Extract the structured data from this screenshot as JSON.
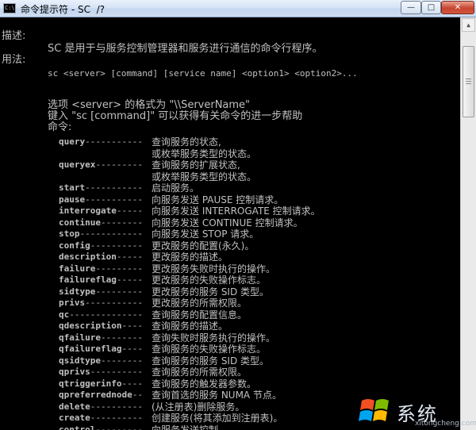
{
  "window": {
    "title": "命令提示符 - SC  /?",
    "icon_text": "C:\\",
    "controls": {
      "minimize": "—",
      "maximize": "□",
      "close": "✕"
    }
  },
  "console": {
    "describe_label": "描述:",
    "describe_text": "SC 是用于与服务控制管理器和服务进行通信的命令行程序。",
    "usage_label": "用法:",
    "usage_text": "sc <server> [command] [service name] <option1> <option2>...",
    "option_line": "选项 <server> 的格式为 \"\\\\ServerName\"",
    "help_line": "键入 \"sc [command]\" 可以获得有关命令的进一步帮助",
    "commands_label": "命令:",
    "commands": [
      {
        "name": "query",
        "dashes": "-----------",
        "desc": "查询服务的状态,",
        "desc2": "或枚举服务类型的状态。"
      },
      {
        "name": "queryex",
        "dashes": "---------",
        "desc": "查询服务的扩展状态,",
        "desc2": "或枚举服务类型的状态。"
      },
      {
        "name": "start",
        "dashes": "-----------",
        "desc": "启动服务。"
      },
      {
        "name": "pause",
        "dashes": "-----------",
        "desc": "向服务发送 PAUSE 控制请求。"
      },
      {
        "name": "interrogate",
        "dashes": "-----",
        "desc": "向服务发送 INTERROGATE 控制请求。"
      },
      {
        "name": "continue",
        "dashes": "--------",
        "desc": "向服务发送 CONTINUE 控制请求。"
      },
      {
        "name": "stop",
        "dashes": "------------",
        "desc": "向服务发送 STOP 请求。"
      },
      {
        "name": "config",
        "dashes": "----------",
        "desc": "更改服务的配置(永久)。"
      },
      {
        "name": "description",
        "dashes": "-----",
        "desc": "更改服务的描述。"
      },
      {
        "name": "failure",
        "dashes": "---------",
        "desc": "更改服务失败时执行的操作。"
      },
      {
        "name": "failureflag",
        "dashes": "-----",
        "desc": "更改服务的失败操作标志。"
      },
      {
        "name": "sidtype",
        "dashes": "---------",
        "desc": "更改服务的服务 SID 类型。"
      },
      {
        "name": "privs",
        "dashes": "-----------",
        "desc": "更改服务的所需权限。"
      },
      {
        "name": "qc",
        "dashes": "--------------",
        "desc": "查询服务的配置信息。"
      },
      {
        "name": "qdescription",
        "dashes": "----",
        "desc": "查询服务的描述。"
      },
      {
        "name": "qfailure",
        "dashes": "--------",
        "desc": "查询失败时服务执行的操作。"
      },
      {
        "name": "qfailureflag",
        "dashes": "----",
        "desc": "查询服务的失败操作标志。"
      },
      {
        "name": "qsidtype",
        "dashes": "--------",
        "desc": "查询服务的服务 SID 类型。"
      },
      {
        "name": "qprivs",
        "dashes": "----------",
        "desc": "查询服务的所需权限。"
      },
      {
        "name": "qtriggerinfo",
        "dashes": "----",
        "desc": "查询服务的触发器参数。"
      },
      {
        "name": "qpreferrednode",
        "dashes": "--",
        "desc": "查询首选的服务 NUMA 节点。"
      },
      {
        "name": "delete",
        "dashes": "----------",
        "desc": "(从注册表)删除服务。"
      },
      {
        "name": "create",
        "dashes": "----------",
        "desc": "创建服务(将其添加到注册表)。"
      },
      {
        "name": "control",
        "dashes": "---------",
        "desc": "向服务发送控制。"
      }
    ]
  },
  "watermark": {
    "text": "系统",
    "url": "xitongcheng.com"
  }
}
